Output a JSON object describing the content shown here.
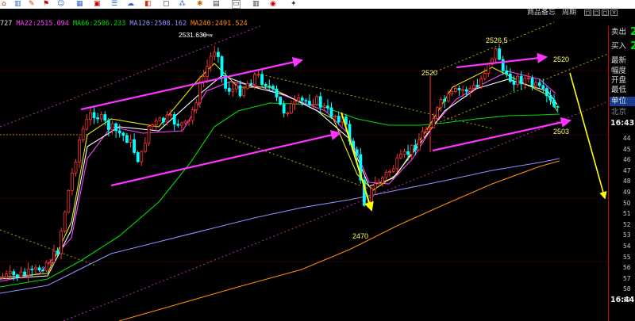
{
  "toolbar": {
    "icons": [
      "home-icon",
      "chart-icon",
      "pin-icon",
      "flag-icon",
      "person-icon",
      "grid-icon",
      "calendar-icon",
      "list-icon",
      "cloud-icon",
      "box-icon",
      "square-icon",
      "dots-icon",
      "star-icon"
    ]
  },
  "subbar": {
    "tab1": "商品备忘",
    "tab2": "周期",
    "buttons": [
      "◻",
      "◻",
      "◻",
      "×"
    ]
  },
  "ma_legend": {
    "prefix": "727",
    "ma22": "MA22:2515.094",
    "ma66": "MA66:2506.233",
    "ma120": "MA120:2508.162",
    "ma240": "MA240:2491.524",
    "colors": {
      "prefix": "#e0e0e0",
      "ma22": "#ff40ff",
      "ma66": "#00dd00",
      "ma120": "#9090ff",
      "ma240": "#ff8c00"
    }
  },
  "annotations": {
    "high1": "2531.630→",
    "high2": "2526.5",
    "l2520a": "2520",
    "l2520b": "2520",
    "low": "2470",
    "l2503": "2503"
  },
  "side": {
    "sell_label": "卖出",
    "sell_val": "2",
    "buy_label": "买入",
    "buy_val": "2",
    "latest": "最新",
    "range": "幅度",
    "open": "开盘",
    "low": "最低",
    "unit": "单位",
    "city": "北京",
    "time1": "16:43",
    "time2": "16:44",
    "ticks": [
      "44",
      "45",
      "46",
      "47",
      "48",
      "49",
      "50",
      "51",
      "52",
      "53",
      "54",
      "55",
      "56",
      "57",
      "58",
      "59"
    ]
  },
  "colors": {
    "up": "#ff3232",
    "down": "#00ffff",
    "magenta": "#ff33ff",
    "yellow": "#ffff00",
    "ma22": "#ff40ff",
    "ma66": "#00dd00",
    "ma120": "#9090ff",
    "ma240": "#ff8c00"
  }
}
